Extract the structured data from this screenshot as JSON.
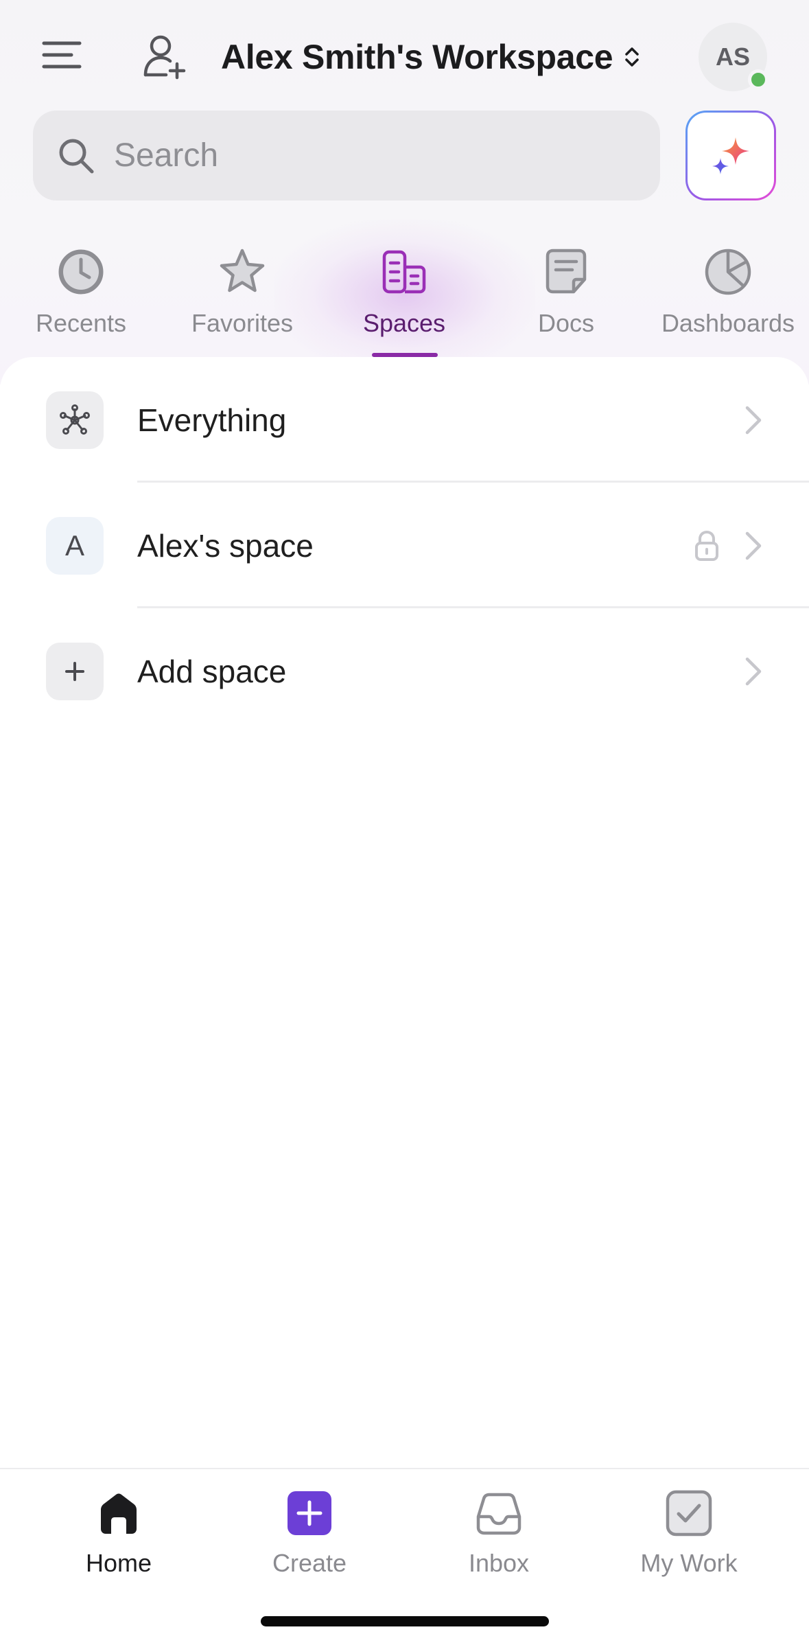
{
  "header": {
    "workspace_name": "Alex Smith's Workspace",
    "avatar_initials": "AS"
  },
  "search": {
    "placeholder": "Search",
    "value": ""
  },
  "tabs": [
    {
      "label": "Recents",
      "icon": "clock-icon"
    },
    {
      "label": "Favorites",
      "icon": "star-icon"
    },
    {
      "label": "Spaces",
      "icon": "spaces-icon",
      "active": true
    },
    {
      "label": "Docs",
      "icon": "doc-icon"
    },
    {
      "label": "Dashboards",
      "icon": "pie-chart-icon"
    }
  ],
  "rows": [
    {
      "label": "Everything",
      "icon": "hub-icon"
    },
    {
      "label": "Alex's space",
      "icon_letter": "A",
      "locked": true
    },
    {
      "label": "Add space",
      "icon": "plus-icon"
    }
  ],
  "bottom_nav": [
    {
      "label": "Home",
      "icon": "home-icon",
      "active": true
    },
    {
      "label": "Create",
      "icon": "create-plus-icon"
    },
    {
      "label": "Inbox",
      "icon": "inbox-icon"
    },
    {
      "label": "My Work",
      "icon": "checkbox-icon"
    }
  ],
  "colors": {
    "accent_purple": "#8a2aa6",
    "create_button": "#6c3fd6",
    "online_status": "#5bb85c"
  }
}
